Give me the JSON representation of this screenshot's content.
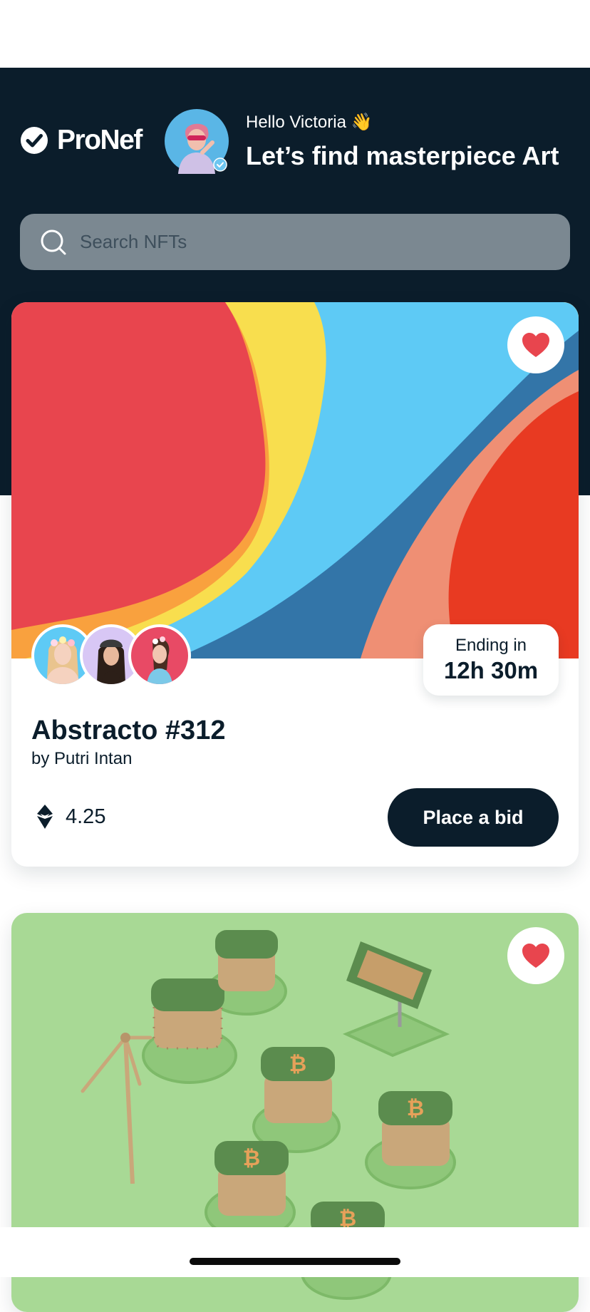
{
  "app": {
    "name": "ProNef"
  },
  "header": {
    "greeting": "Hello Victoria 👋",
    "headline": "Let’s find masterpiece Art"
  },
  "search": {
    "placeholder": "Search NFTs"
  },
  "cards": [
    {
      "title": "Abstracto #312",
      "author": "by Putri Intan",
      "ending_label": "Ending in",
      "ending_value": "12h 30m",
      "price": "4.25",
      "bid_label": "Place a bid",
      "favorited": true
    },
    {
      "favorited": true
    }
  ],
  "colors": {
    "navy": "#0b1d2b",
    "heart": "#e8454e",
    "search_bg": "#7b8891",
    "art_red": "#e8454e",
    "art_yellow": "#f8de4e",
    "art_sky": "#5ecaf5",
    "art_blue": "#3375a8",
    "art_salmon": "#ef8f74",
    "art_orange_red": "#e83a22",
    "green_bg": "#a8d995"
  },
  "icons": {
    "logo": "check-circle-icon",
    "search": "search-icon",
    "favorite": "heart-icon",
    "currency": "ethereum-icon"
  }
}
